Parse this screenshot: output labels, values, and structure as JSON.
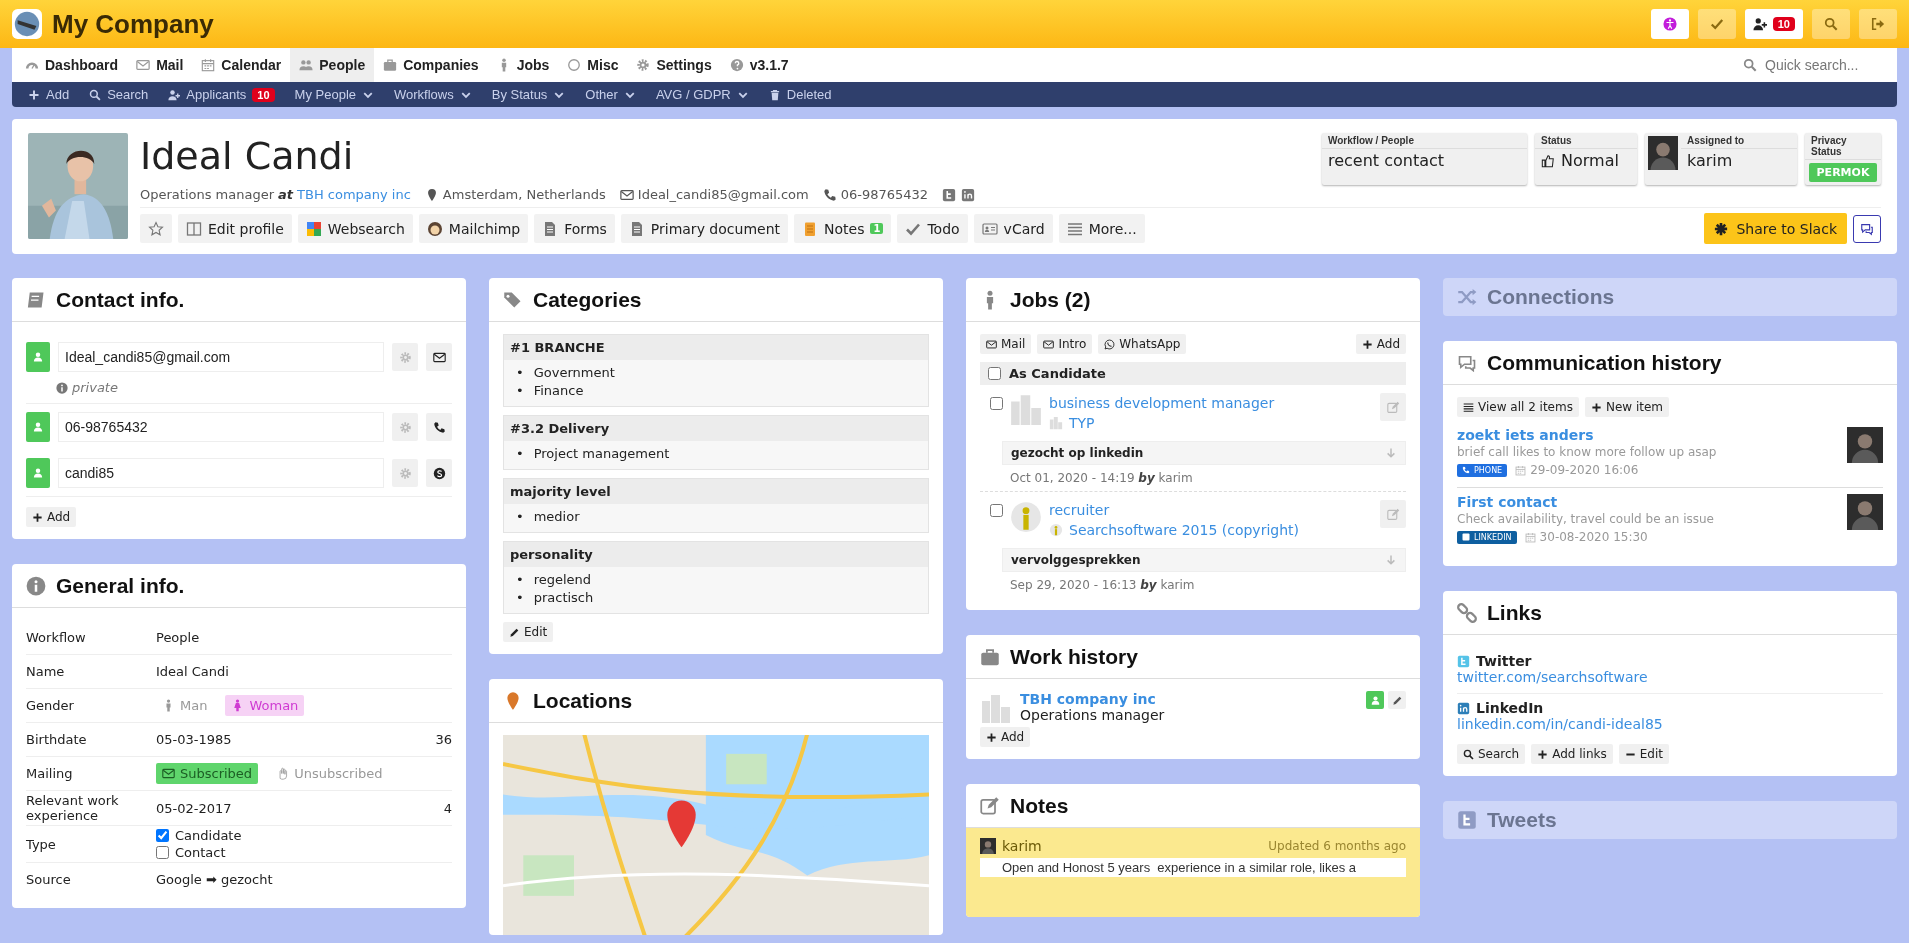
{
  "app": {
    "title": "My Company",
    "top_buttons": [
      {
        "kind": "accessibility"
      },
      {
        "kind": "check"
      },
      {
        "kind": "add-user",
        "badge": "10"
      },
      {
        "kind": "search"
      },
      {
        "kind": "logout"
      }
    ]
  },
  "main_nav": {
    "items": [
      {
        "label": "Dashboard",
        "kind": "gauge",
        "selected": false
      },
      {
        "label": "Mail",
        "kind": "mail",
        "selected": false
      },
      {
        "label": "Calendar",
        "kind": "calendar",
        "selected": false
      },
      {
        "label": "People",
        "kind": "people",
        "selected": true
      },
      {
        "label": "Companies",
        "kind": "briefcase",
        "selected": false
      },
      {
        "label": "Jobs",
        "kind": "person",
        "selected": false
      },
      {
        "label": "Misc",
        "kind": "circle",
        "selected": false
      },
      {
        "label": "Settings",
        "kind": "gear",
        "selected": false
      },
      {
        "label": "v3.1.7",
        "kind": "help",
        "selected": false
      }
    ],
    "search_placeholder": "Quick search..."
  },
  "sub_nav": [
    {
      "label": "Add",
      "kind": "plus"
    },
    {
      "label": "Search",
      "kind": "search"
    },
    {
      "label": "Applicants",
      "kind": "add-user",
      "badge": "10"
    },
    {
      "label": "My People",
      "kind": "dropdown"
    },
    {
      "label": "Workflows",
      "kind": "dropdown"
    },
    {
      "label": "By Status",
      "kind": "dropdown"
    },
    {
      "label": "Other",
      "kind": "dropdown"
    },
    {
      "label": "AVG / GDPR",
      "kind": "dropdown"
    },
    {
      "label": "Deleted",
      "kind": "trash"
    }
  ],
  "profile": {
    "name": "Ideal Candi",
    "role": "Operations manager",
    "at": "at",
    "company": "TBH company inc",
    "location": "Amsterdam, Netherlands",
    "email": "Ideal_candi85@gmail.com",
    "phone": "06-98765432",
    "social": [
      {
        "kind": "twitter"
      },
      {
        "kind": "linkedin"
      }
    ],
    "actions": [
      {
        "label": "Edit profile",
        "kind": "columns"
      },
      {
        "label": "Websearch",
        "kind": "colorgrid"
      },
      {
        "label": "Mailchimp",
        "kind": "roundlogo"
      },
      {
        "label": "Forms",
        "kind": "document"
      },
      {
        "label": "Primary document",
        "kind": "document"
      },
      {
        "label": "Notes",
        "kind": "notepad",
        "badge": "1"
      },
      {
        "label": "Todo",
        "kind": "check"
      },
      {
        "label": "vCard",
        "kind": "card"
      },
      {
        "label": "More...",
        "kind": "list"
      }
    ],
    "info_boxes": [
      {
        "label": "Workflow / People",
        "value": "recent contact",
        "kind": "text"
      },
      {
        "label": "Status",
        "value": "Normal",
        "kind": "thumb"
      },
      {
        "label": "Assigned to",
        "value": "karim",
        "kind": "avatar"
      },
      {
        "label": "Privacy Status",
        "value": "PERMOK",
        "kind": "badge"
      }
    ],
    "share": "Share to Slack"
  },
  "contact_info": {
    "title": "Contact info.",
    "entries": [
      {
        "value": "Ideal_candi85@gmail.com",
        "kind": "mail",
        "note": "private"
      },
      {
        "value": "06-98765432",
        "kind": "phone"
      },
      {
        "value": "candi85",
        "kind": "skype"
      }
    ],
    "add": "Add"
  },
  "general_info": {
    "title": "General info.",
    "rows": [
      {
        "kind": "text",
        "label": "Workflow",
        "value": "People"
      },
      {
        "kind": "text",
        "label": "Name",
        "value": "Ideal Candi"
      },
      {
        "kind": "choice",
        "label": "Gender",
        "options": [
          {
            "label": "Man",
            "kind": "man",
            "selected": false
          },
          {
            "label": "Woman",
            "kind": "woman",
            "selected": true
          }
        ]
      },
      {
        "kind": "text",
        "label": "Birthdate",
        "value": "05-03-1985",
        "extra": "36"
      },
      {
        "kind": "choice",
        "label": "Mailing",
        "options": [
          {
            "label": "Subscribed",
            "kind": "mail",
            "selected": true
          },
          {
            "label": "Unsubscribed",
            "kind": "hand",
            "selected": false
          }
        ]
      },
      {
        "kind": "text",
        "label": "Relevant work experience",
        "value": "05-02-2017",
        "extra": "4"
      },
      {
        "kind": "checks",
        "label": "Type",
        "options": [
          {
            "label": "Candidate",
            "checked": true
          },
          {
            "label": "Contact",
            "checked": false
          }
        ]
      },
      {
        "kind": "text",
        "label": "Source",
        "value": "Google ➡ gezocht"
      }
    ]
  },
  "categories": {
    "title": "Categories",
    "groups": [
      {
        "name": "#1 BRANCHE",
        "items": [
          {
            "bullet": "•",
            "label": "Government"
          },
          {
            "bullet": "•",
            "label": "Finance"
          }
        ]
      },
      {
        "name": "#3.2 Delivery",
        "items": [
          {
            "bullet": "•",
            "label": "Project management"
          }
        ]
      },
      {
        "name": "majority level",
        "items": [
          {
            "bullet": "•",
            "label": "medior"
          }
        ]
      },
      {
        "name": "personality",
        "items": [
          {
            "bullet": "•",
            "label": "regelend"
          },
          {
            "bullet": "•",
            "label": "practisch"
          }
        ]
      }
    ],
    "edit": "Edit"
  },
  "locations": {
    "title": "Locations"
  },
  "jobs": {
    "title": "Jobs (2)",
    "actions": [
      {
        "label": "Mail",
        "kind": "mail"
      },
      {
        "label": "Intro",
        "kind": "mail"
      },
      {
        "label": "WhatsApp",
        "kind": "whatsapp"
      }
    ],
    "add": "Add",
    "group": {
      "label": "As Candidate",
      "checked": false
    },
    "items": [
      {
        "title": "business development manager",
        "company": "TYP",
        "kind": "building",
        "stage": "gezocht op linkedin",
        "date": "Oct 01, 2020 - 14:19 **by** karim",
        "checked": false
      },
      {
        "title": "recruiter",
        "company": "Searchsoftware 2015 (copyright)",
        "kind": "emblem",
        "stage": "vervolggesprekken",
        "date": "Sep 29, 2020 - 16:13 **by** karim",
        "checked": false
      }
    ]
  },
  "work_history": {
    "title": "Work history",
    "items": [
      {
        "company": "TBH company inc",
        "role": "Operations manager"
      }
    ],
    "add": "Add"
  },
  "notes": {
    "title": "Notes",
    "items": [
      {
        "author": "karim",
        "updated": "Updated 6 months ago",
        "text": "Open and Honost 5 years  experience in a similar role, likes a"
      }
    ]
  },
  "connections": {
    "title": "Connections",
    "collapsed": true
  },
  "communication": {
    "title": "Communication history",
    "view_all": "View all 2 items",
    "new_item": "New item",
    "items": [
      {
        "title": "zoekt iets anders",
        "text": "brief call likes to know more follow up asap",
        "channel": "PHONE",
        "kind": "phone",
        "color": "#1f6fe0",
        "date": "29-09-2020 16:06"
      },
      {
        "title": "First contact",
        "text": "Check availability, travel could be an issue",
        "channel": "LINKEDIN",
        "kind": "linkedin",
        "color": "#0e5fa0",
        "date": "30-08-2020 15:30"
      }
    ]
  },
  "links": {
    "title": "Links",
    "items": [
      {
        "kind": "twitter",
        "label": "Twitter",
        "url": "twitter.com/searchsoftware"
      },
      {
        "kind": "linkedin",
        "label": "LinkedIn",
        "url": "linkedin.com/in/candi-ideal85"
      }
    ],
    "actions": [
      {
        "label": "Search",
        "kind": "search"
      },
      {
        "label": "Add links",
        "kind": "plus"
      },
      {
        "label": "Edit",
        "kind": "minus"
      }
    ]
  },
  "tweets": {
    "title": "Tweets",
    "collapsed": true
  }
}
